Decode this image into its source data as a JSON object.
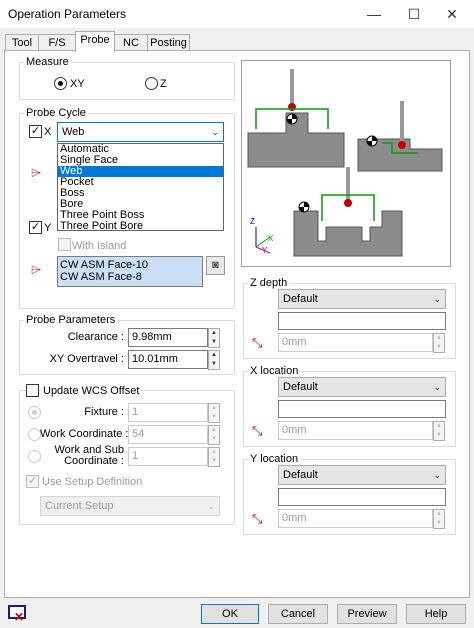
{
  "window": {
    "title": "Operation Parameters",
    "minimize": "—",
    "maximize": "☐",
    "close": "✕"
  },
  "tabs": [
    "Tool",
    "F/S",
    "Probe",
    "NC",
    "Posting"
  ],
  "active_tab": "Probe",
  "measure": {
    "label": "Measure",
    "options": [
      "XY",
      "Z"
    ],
    "selected": "XY"
  },
  "probe_cycle": {
    "label": "Probe Cycle",
    "x": {
      "label": "X",
      "checked": true,
      "value": "Web"
    },
    "dropdown_options": [
      "Automatic",
      "Single Face",
      "Web",
      "Pocket",
      "Boss",
      "Bore",
      "Three Point Boss",
      "Three Point Bore"
    ],
    "dropdown_selected": "Web",
    "y": {
      "label": "Y",
      "checked": true
    },
    "with_island": {
      "label": "With Island",
      "checked": false
    },
    "faces": [
      "CW ASM Face-10",
      "CW ASM Face-8"
    ]
  },
  "probe_parameters": {
    "label": "Probe Parameters",
    "clearance": {
      "label": "Clearance :",
      "value": "9.98mm"
    },
    "xy_overtravel": {
      "label": "XY Overtravel :",
      "value": "10.01mm"
    }
  },
  "wcs": {
    "label": "Update WCS Offset",
    "checked": false,
    "fixture": {
      "label": "Fixture :",
      "value": "1"
    },
    "work_coordinate": {
      "label": "Work Coordinate :",
      "value": "54"
    },
    "work_sub": {
      "label_line1": "Work and Sub",
      "label_line2": "Coordinate :",
      "value": "1"
    },
    "use_setup": {
      "label": "Use Setup Definition",
      "checked": true
    },
    "setup_combo": "Current Setup"
  },
  "z_depth": {
    "label": "Z depth",
    "combo": "Default",
    "text": "",
    "distance": "0mm"
  },
  "x_location": {
    "label": "X location",
    "combo": "Default",
    "text": "",
    "distance": "0mm"
  },
  "y_location": {
    "label": "Y location",
    "combo": "Default",
    "text": "",
    "distance": "0mm"
  },
  "axes": {
    "z": "Z",
    "x": "X",
    "y": "Y"
  },
  "buttons": {
    "ok": "OK",
    "cancel": "Cancel",
    "preview": "Preview",
    "help": "Help"
  }
}
